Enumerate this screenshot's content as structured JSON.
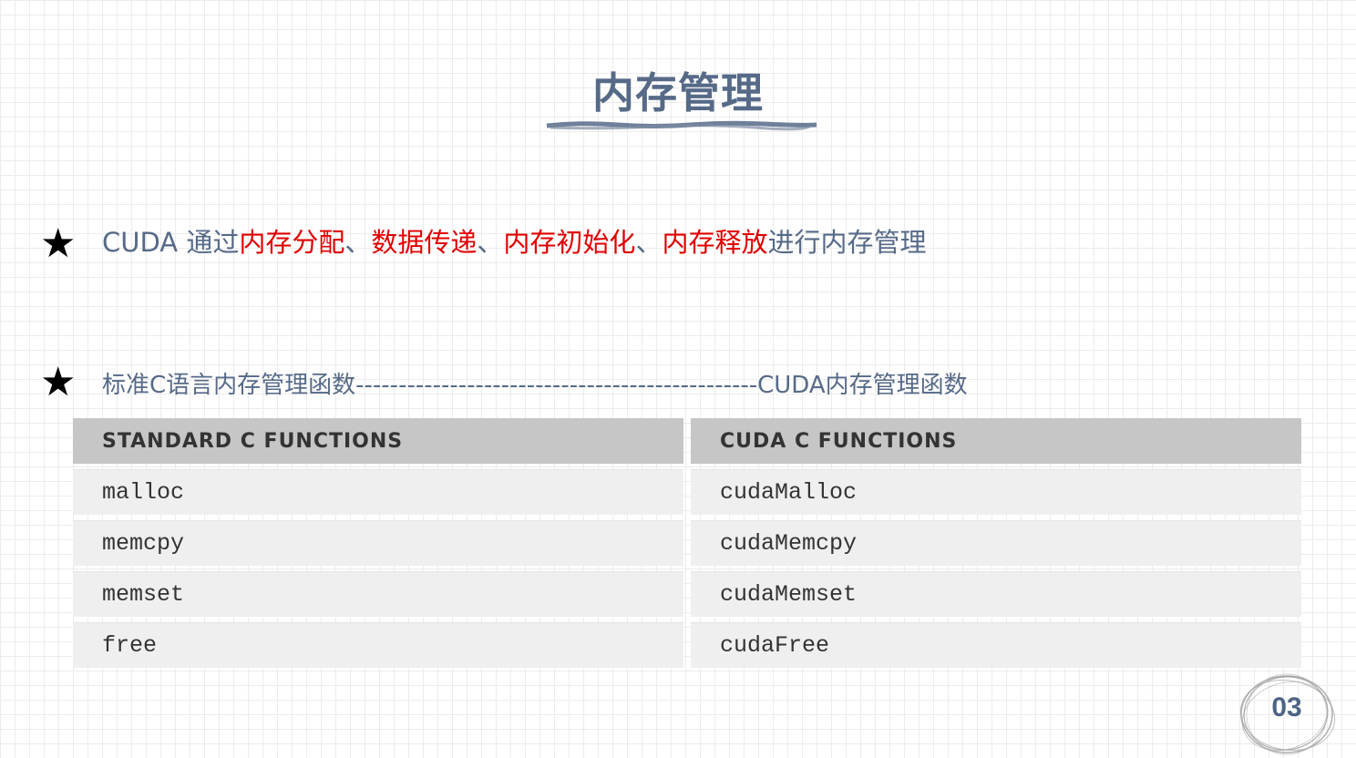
{
  "title": "内存管理",
  "bullet1": {
    "prefix": "CUDA 通过",
    "item1": "内存分配",
    "sep1": "、",
    "item2": "数据传递",
    "sep2": "、",
    "item3": "内存初始化",
    "sep3": "、",
    "item4": "内存释放",
    "suffix": "进行内存管理"
  },
  "bullet2": {
    "text": "标准C语言内存管理函数-----------------------------------------------CUDA内存管理函数"
  },
  "table": {
    "headers": [
      "STANDARD C FUNCTIONS",
      "CUDA C FUNCTIONS"
    ],
    "rows": [
      [
        "malloc",
        "cudaMalloc"
      ],
      [
        "memcpy",
        "cudaMemcpy"
      ],
      [
        "memset",
        "cudaMemset"
      ],
      [
        "free",
        "cudaFree"
      ]
    ]
  },
  "page_number": "03",
  "colors": {
    "title": "#566a88",
    "highlight": "#e00000",
    "header_bg": "#c6c6c6",
    "row_bg": "#efefef"
  }
}
